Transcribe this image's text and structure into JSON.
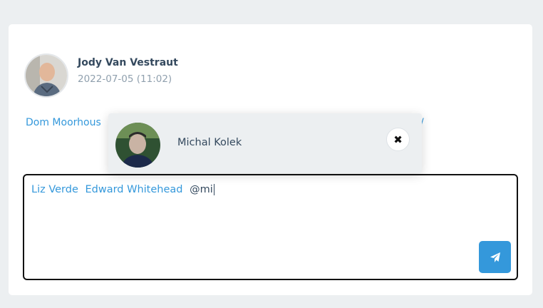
{
  "post": {
    "author_name": "Jody Van Vestraut",
    "timestamp": "2022-07-05 (11:02)",
    "comment_visible_start": "Dom Moorhous",
    "comment_visible_end": "/"
  },
  "reply": {
    "mentions": [
      "Liz Verde",
      "Edward Whitehead"
    ],
    "typed_text": "@mi",
    "send_icon": "paper-plane-icon"
  },
  "mention_suggestion": {
    "name": "Michal Kolek",
    "close_icon": "close-icon"
  },
  "colors": {
    "accent": "#3498db",
    "text_dark": "#34495e",
    "text_muted": "#90a0ae",
    "background": "#eceff1"
  }
}
